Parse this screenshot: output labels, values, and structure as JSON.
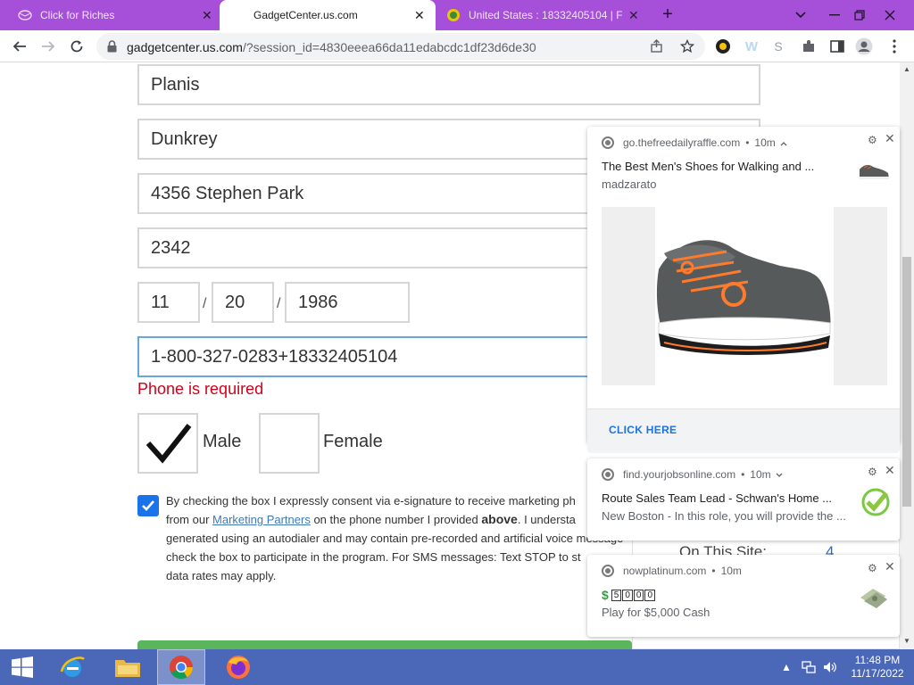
{
  "browser": {
    "tabs": [
      {
        "label": "Click for Riches"
      },
      {
        "label": "GadgetCenter.us.com"
      },
      {
        "label": "United States : 18332405104 | Free"
      }
    ],
    "url_host": "gadgetcenter.us.com",
    "url_path": "/?session_id=4830eeea66da11edabcdc1df23d6de30"
  },
  "form": {
    "first_name": "Planis",
    "last_name": "Dunkrey",
    "address": "4356 Stephen Park",
    "zip": "2342",
    "dob_month": "11",
    "dob_day": "20",
    "dob_year": "1986",
    "dob_sep": "/",
    "phone": "1-800-327-0283+18332405104",
    "phone_error": "Phone is required",
    "gender_male": "Male",
    "gender_female": "Female",
    "consent_checked": true,
    "consent": {
      "line1": "By checking the box I expressly consent via e-signature to receive marketing ph",
      "line2_pre": "from our ",
      "line2_link": "Marketing Partners",
      "line2_mid": " on the phone number I provided ",
      "line2_bold": "above",
      "line2_post": ". I understa",
      "line3": "generated using an autodialer and may contain pre-recorded and artificial voice message",
      "line4": "check the box to participate in the program. For SMS messages: Text STOP to st",
      "line5": "data rates may apply."
    }
  },
  "sidebar": {
    "on_this_site_label": "On This Site:",
    "on_this_site_count": "4"
  },
  "notifications": [
    {
      "source": "go.thefreedailyraffle.com",
      "sep": "•",
      "time": "10m",
      "title": "The Best Men's Shoes for Walking and ...",
      "body": "madzarato",
      "action": "CLICK HERE",
      "icon": "shoe-image"
    },
    {
      "source": "find.yourjobsonline.com",
      "sep": "•",
      "time": "10m",
      "title": "Route Sales Team Lead - Schwan's Home ...",
      "body": "New Boston - In this role, you will provide the ...",
      "icon": "green-check-icon"
    },
    {
      "source": "nowplatinum.com",
      "sep": "•",
      "time": "10m",
      "title_prefix": "$",
      "title_digits": [
        "5",
        "0",
        "0",
        "0"
      ],
      "body": "Play for $5,000 Cash",
      "icon": "cash-image"
    }
  ],
  "taskbar": {
    "time": "11:48 PM",
    "date": "11/17/2022"
  },
  "colors": {
    "tab_strip": "#a64fd8",
    "error": "#d0021b",
    "link": "#3d7ab5",
    "checkbox_blue": "#1a73e8",
    "taskbar": "#4a67b8",
    "green_button": "#5bb55c"
  }
}
